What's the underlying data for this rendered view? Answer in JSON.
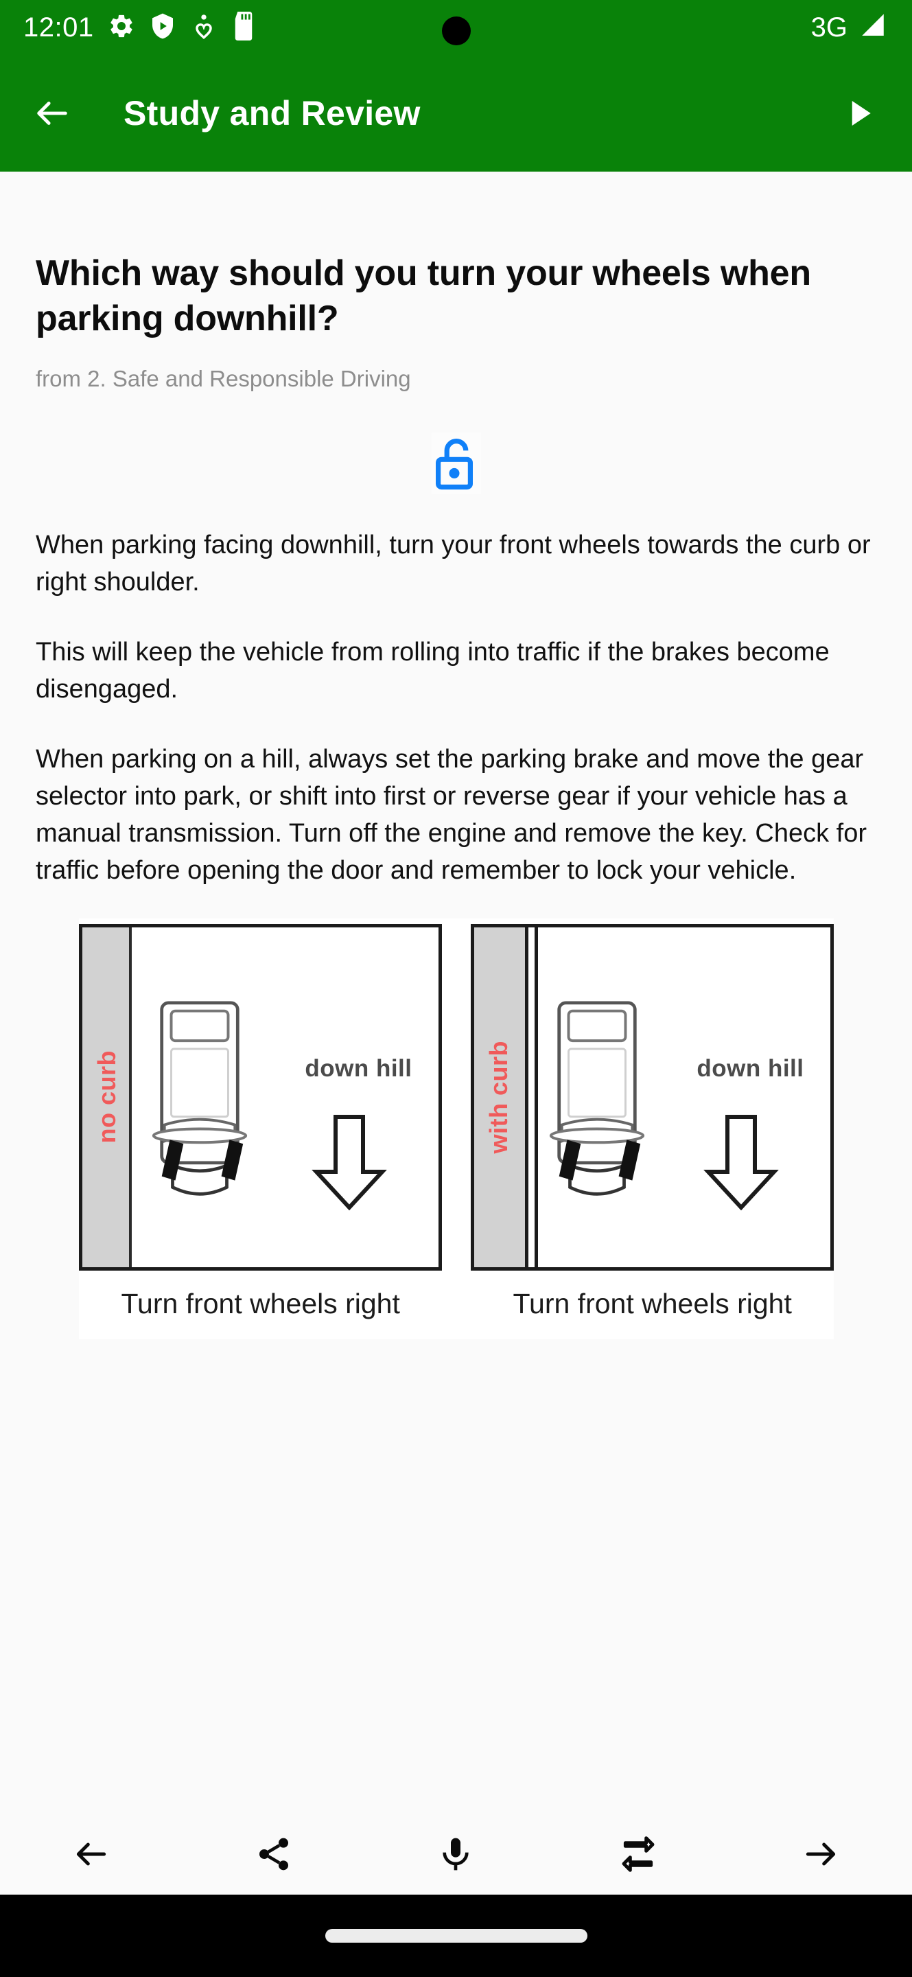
{
  "status_bar": {
    "time": "12:01",
    "network": "3G",
    "icons": [
      "gear-icon",
      "shield-play-icon",
      "accessibility-icon",
      "sd-card-icon"
    ],
    "signal_icon": "signal-bars-icon",
    "background_color": "#098209"
  },
  "app_bar": {
    "title": "Study and Review",
    "back_icon": "arrow-left-icon",
    "play_icon": "play-icon",
    "background_color": "#098209",
    "text_color": "#ffffff"
  },
  "card": {
    "question": "Which way should you turn your wheels when parking downhill?",
    "source": "from 2. Safe and Responsible Driving",
    "status_icon": "unlocked-padlock-icon",
    "status_icon_color": "#1080f8",
    "paragraphs": [
      "When parking facing downhill, turn your front wheels towards the curb or right shoulder.",
      "This will keep the vehicle from rolling into traffic if the brakes become disengaged.",
      "When parking on a hill, always set the parking brake and move the gear selector into park, or shift into first or reverse gear if your vehicle has a manual transmission. Turn off the engine and remove the key. Check for traffic before opening the door and remember to lock your vehicle."
    ]
  },
  "figure": {
    "panels": [
      {
        "curb_label": "no curb",
        "slope_label": "down hill",
        "caption": "Turn front wheels right",
        "curb_type": "none"
      },
      {
        "curb_label": "with curb",
        "slope_label": "down hill",
        "caption": "Turn front wheels right",
        "curb_type": "curb"
      }
    ],
    "curb_label_color": "#f05a5a",
    "arrow_icon": "arrow-down-icon"
  },
  "toolbar": {
    "items": [
      {
        "name": "previous-button",
        "icon": "arrow-left-icon"
      },
      {
        "name": "share-button",
        "icon": "share-icon"
      },
      {
        "name": "microphone-button",
        "icon": "microphone-icon"
      },
      {
        "name": "repeat-button",
        "icon": "repeat-icon"
      },
      {
        "name": "next-button",
        "icon": "arrow-right-icon"
      }
    ]
  },
  "nav_bar": {
    "home_indicator": "home-pill"
  }
}
